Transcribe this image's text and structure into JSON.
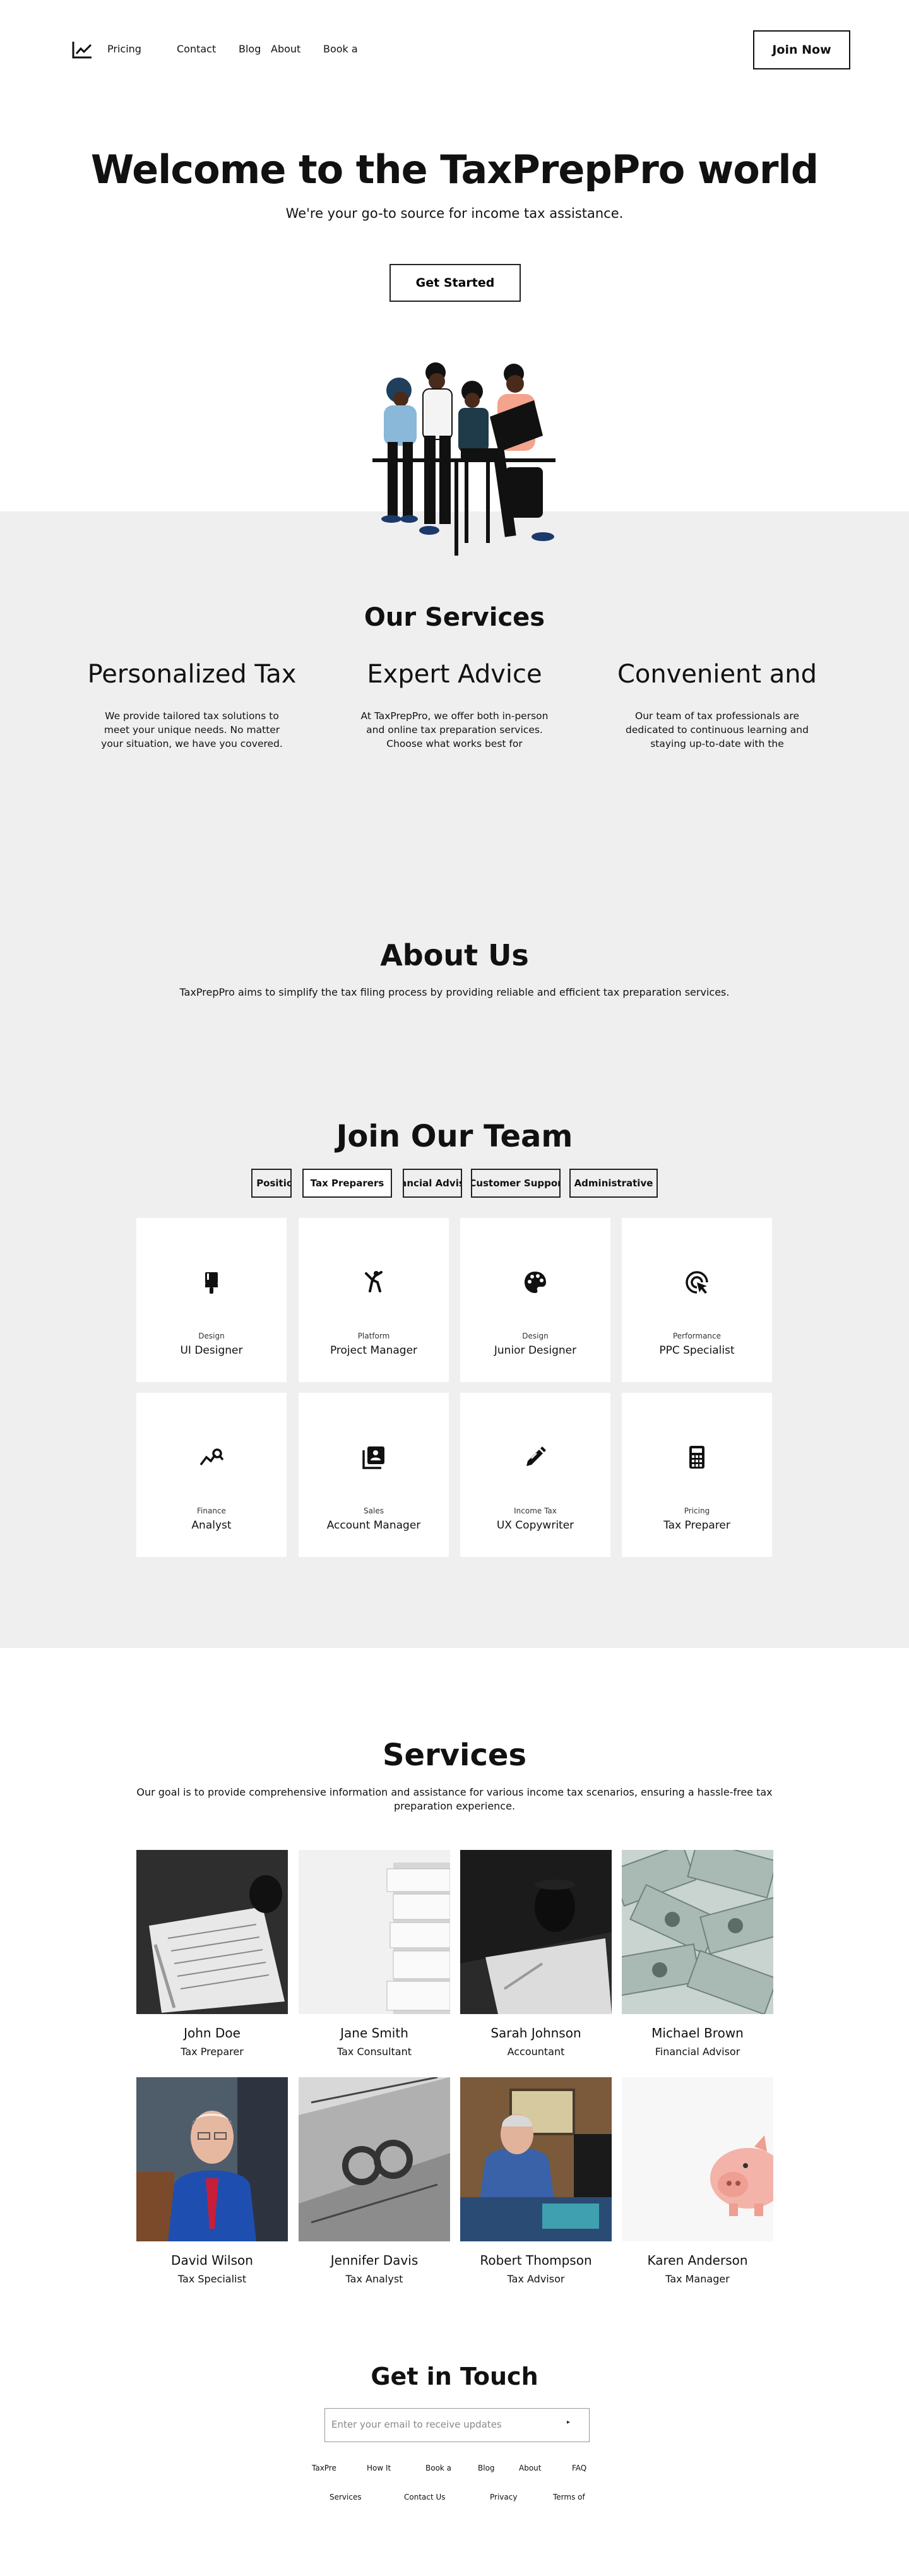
{
  "nav": {
    "logo_icon": "trend-chart-icon",
    "links": [
      "Pricing",
      "Contact",
      "Blog",
      "About",
      "Book a"
    ],
    "join_label": "Join Now"
  },
  "hero": {
    "title": "Welcome to the TaxPrepPro world",
    "subtitle": "We're your go-to source for income tax assistance.",
    "cta_label": "Get Started"
  },
  "our_services": {
    "title": "Our Services",
    "columns": [
      {
        "title": "Personalized Tax",
        "text": "We provide tailored tax solutions to meet your unique needs. No matter your situation, we have you covered."
      },
      {
        "title": "Expert Advice",
        "text": "At TaxPrepPro, we offer both in-person and online tax preparation services. Choose what works best for"
      },
      {
        "title": "Convenient and",
        "text": "Our team of tax professionals are dedicated to continuous learning and staying up-to-date with the"
      }
    ]
  },
  "about": {
    "title": "About Us",
    "text": "TaxPrepPro aims to simplify the tax filing process by providing reliable and efficient tax preparation services."
  },
  "team": {
    "title": "Join Our Team",
    "tabs": [
      "l Positio",
      "Tax Preparers",
      "ancial Advis",
      "Customer Suppor",
      "Administrative"
    ],
    "jobs": [
      {
        "category": "Design",
        "title": "UI Designer",
        "icon": "paint-brush-icon"
      },
      {
        "category": "Platform",
        "title": "Project Manager",
        "icon": "sports-figure-icon"
      },
      {
        "category": "Design",
        "title": "Junior Designer",
        "icon": "palette-icon"
      },
      {
        "category": "Performance",
        "title": "PPC Specialist",
        "icon": "ads-click-icon"
      },
      {
        "category": "Finance",
        "title": "Analyst",
        "icon": "query-stats-icon"
      },
      {
        "category": "Sales",
        "title": "Account Manager",
        "icon": "contact-book-icon"
      },
      {
        "category": "Income Tax",
        "title": "UX Copywriter",
        "icon": "edit-pen-icon"
      },
      {
        "category": "Pricing",
        "title": "Tax Preparer",
        "icon": "calculator-icon"
      }
    ]
  },
  "services": {
    "title": "Services",
    "text": "Our goal is to provide comprehensive information and assistance for various income tax scenarios, ensuring a hassle-free tax preparation experience.",
    "people": [
      {
        "name": "John Doe",
        "role": "Tax Preparer"
      },
      {
        "name": "Jane Smith",
        "role": "Tax Consultant"
      },
      {
        "name": "Sarah Johnson",
        "role": "Accountant"
      },
      {
        "name": "Michael Brown",
        "role": "Financial Advisor"
      },
      {
        "name": "David Wilson",
        "role": "Tax Specialist"
      },
      {
        "name": "Jennifer Davis",
        "role": "Tax Analyst"
      },
      {
        "name": "Robert Thompson",
        "role": "Tax Advisor"
      },
      {
        "name": "Karen Anderson",
        "role": "Tax Manager"
      }
    ]
  },
  "contact": {
    "title": "Get in Touch",
    "email_placeholder": "Enter your email to receive updates",
    "submit_icon": "arrow-right-icon",
    "links_row1": [
      "TaxPre",
      "How It",
      "Book a",
      "Blog",
      "About",
      "FAQ"
    ],
    "links_row2": [
      "Services",
      "Contact Us",
      "Privacy",
      "Terms of"
    ]
  }
}
